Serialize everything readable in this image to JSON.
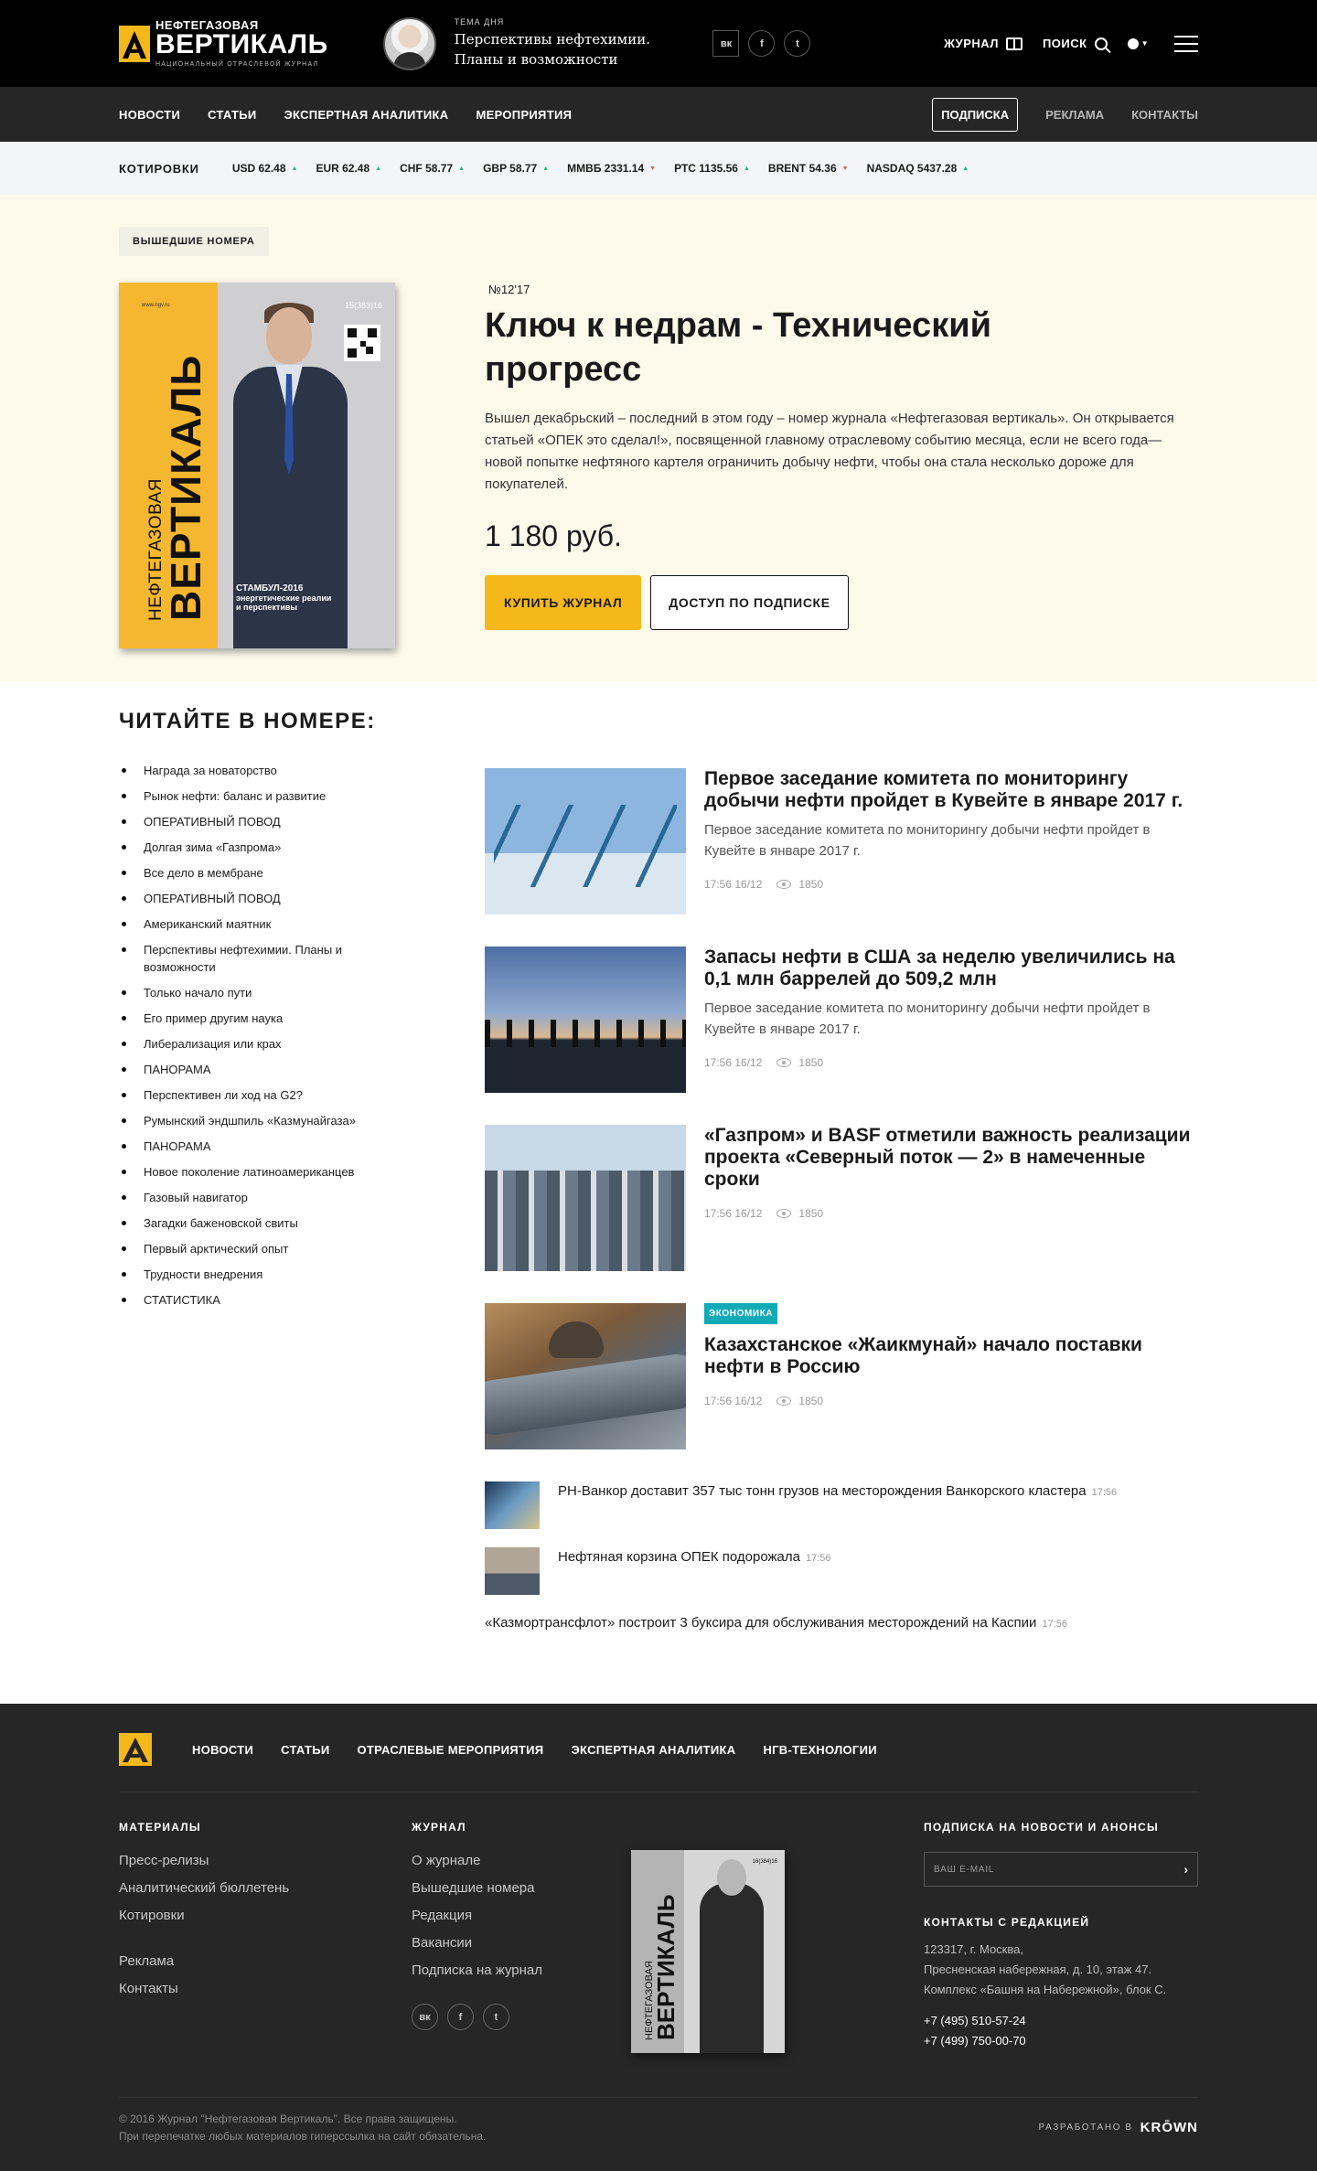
{
  "header": {
    "logo": {
      "line1": "НЕФТЕГАЗОВАЯ",
      "line2": "ВЕРТИКАЛЬ",
      "line3": "НАЦИОНАЛЬНЫЙ ОТРАСЛЕВОЙ ЖУРНАЛ",
      "accent_color": "#f5b81a"
    },
    "theme": {
      "label": "ТЕМА ДНЯ",
      "title": "Перспективы нефтехимии. Планы и возможности"
    },
    "socials": [
      {
        "label": "вк",
        "icon": "vk-icon"
      },
      {
        "label": "f",
        "icon": "facebook-icon"
      },
      {
        "label": "t",
        "icon": "twitter-icon"
      }
    ],
    "journal_label": "ЖУРНАЛ",
    "search_label": "ПОИСК"
  },
  "nav": {
    "items": [
      "НОВОСТИ",
      "СТАТЬИ",
      "ЭКСПЕРТНАЯ АНАЛИТИКА",
      "МЕРОПРИЯТИЯ"
    ],
    "subscribe": "ПОДПИСКА",
    "ads": "РЕКЛАМА",
    "contacts": "КОНТАКТЫ"
  },
  "quotes": {
    "title": "КОТИРОВКИ",
    "items": [
      {
        "label": "USD 62.48",
        "dir": "up"
      },
      {
        "label": "EUR 62.48",
        "dir": "up"
      },
      {
        "label": "CHF 58.77",
        "dir": "up"
      },
      {
        "label": "GBP 58.77",
        "dir": "up"
      },
      {
        "label": "ММВБ 2331.14",
        "dir": "down"
      },
      {
        "label": "РТС 1135.56",
        "dir": "up"
      },
      {
        "label": "BRENT 54.36",
        "dir": "down"
      },
      {
        "label": "NASDAQ 5437.28",
        "dir": "up"
      }
    ],
    "up_color": "#1fb47a",
    "down_color": "#e45a4a"
  },
  "hero": {
    "issues_button": "ВЫШЕДШИЕ НОМЕРА",
    "cover": {
      "small": "www.ngv.ru",
      "number": "15(383)16",
      "title1": "НЕФТЕГАЗОВАЯ",
      "title2": "ВЕРТИКАЛЬ",
      "caption1": "СТАМБУЛ-2016",
      "caption2": "энергетические реалии",
      "caption3": "и перспективы"
    },
    "issue_number": "№12'17",
    "title": "Ключ к недрам - Технический прогресс",
    "text": "Вышел декабрьский – последний в этом году – номер журнала «Нефтегазовая вертикаль». Он открывается статьей «ОПЕК это сделал!», посвященной главному отраслевому событию месяца, если не всего года—новой попытке нефтяного картеля ограничить добычу нефти, чтобы она стала несколько дороже для покупателей.",
    "price": "1 180 руб.",
    "buy_label": "КУПИТЬ ЖУРНАЛ",
    "access_label": "ДОСТУП ПО ПОДПИСКЕ"
  },
  "content": {
    "read_title": "ЧИТАЙТЕ В НОМЕРЕ:",
    "toc": [
      "Награда за новаторство",
      "Рынок нефти: баланс и развитие",
      "ОПЕРАТИВНЫЙ ПОВОД",
      "Долгая зима «Газпрома»",
      "Все дело в мембране",
      "ОПЕРАТИВНЫЙ ПОВОД",
      "Американский маятник",
      "Перспективы нефтехимии. Планы и возможности",
      "Только начало пути",
      "Его пример другим наука",
      "Либерализация или крах",
      "ПАНОРАМА",
      "Перспективен ли ход на G2?",
      "Румынский эндшпиль «Казмунайгаза»",
      "ПАНОРАМА",
      "Новое поколение латиноамериканцев",
      "Газовый навигатор",
      "Загадки баженовской свиты",
      "Первый арктический опыт",
      "Трудности внедрения",
      "СТАТИСТИКА"
    ],
    "news": [
      {
        "title": "Первое заседание комитета по мониторингу добычи нефти пройдет в Кувейте в январе 2017 г.",
        "lead": "Первое заседание комитета по мониторингу добычи нефти пройдет в Кувейте в январе 2017 г.",
        "time": "17:56 16/12",
        "views": "1850",
        "tag": ""
      },
      {
        "title": "Запасы нефти в США за неделю увеличились на 0,1 млн баррелей до 509,2 млн",
        "lead": "Первое заседание комитета по мониторингу добычи нефти пройдет в Кувейте в январе 2017 г.",
        "time": "17:56 16/12",
        "views": "1850",
        "tag": ""
      },
      {
        "title": "«Газпром» и BASF отметили важность реализации проекта «Северный поток — 2» в намеченные сроки",
        "lead": "",
        "time": "17:56 16/12",
        "views": "1850",
        "tag": ""
      },
      {
        "title": "Казахстанское «Жаикмунай» начало поставки нефти в Россию",
        "lead": "",
        "time": "17:56 16/12",
        "views": "1850",
        "tag": "ЭКОНОМИКА"
      }
    ],
    "briefs": [
      {
        "text": "РН-Ванкор доставит 357 тыс тонн грузов на месторождения Ванкорского кластера",
        "time": "17:56"
      },
      {
        "text": "Нефтяная корзина ОПЕК подорожала",
        "time": "17:56"
      },
      {
        "text": "«Казмортрансфлот» построит 3 буксира для обслуживания месторождений на Каспии",
        "time": "17:56"
      }
    ],
    "tag_color": "#11aab7"
  },
  "footer": {
    "nav": [
      "НОВОСТИ",
      "СТАТЬИ",
      "ОТРАСЛЕВЫЕ МЕРОПРИЯТИЯ",
      "ЭКСПЕРТНАЯ АНАЛИТИКА",
      "НГВ-ТЕХНОЛОГИИ"
    ],
    "materials": {
      "title": "МАТЕРИАЛЫ",
      "links": [
        "Пресс-релизы",
        "Аналитический бюллетень",
        "Котировки"
      ],
      "links2": [
        "Реклама",
        "Контакты"
      ]
    },
    "journal": {
      "title": "ЖУРНАЛ",
      "links": [
        "О журнале",
        "Вышедшие номера",
        "Редакция",
        "Вакансии",
        "Подписка на журнал"
      ]
    },
    "cover": {
      "title1": "НЕФТЕГАЗОВАЯ",
      "title2": "ВЕРТИКАЛЬ",
      "number": "16(384)16"
    },
    "subscribe": {
      "title": "ПОДПИСКА НА НОВОСТИ И АНОНСЫ",
      "placeholder": "ВАШ E-MAIL",
      "arrow": "›"
    },
    "contacts": {
      "title": "КОНТАКТЫ С РЕДАКЦИЕЙ",
      "address": [
        "123317, г. Москва,",
        "Пресненская набережная, д. 10, этаж 47.",
        "Комплекс «Башня на Набережной», блок С."
      ],
      "phones": [
        "+7 (495) 510-57-24",
        "+7 (499) 750-00-70"
      ]
    },
    "copyright": [
      "© 2016 Журнал \"Нефтегазовая Вертикаль\". Все права защищены.",
      "При перепечатке любых материалов гиперссылка на сайт обязательна."
    ],
    "dev_label": "РАЗРАБОТАНО В",
    "dev_brand": "KRŌWN"
  }
}
